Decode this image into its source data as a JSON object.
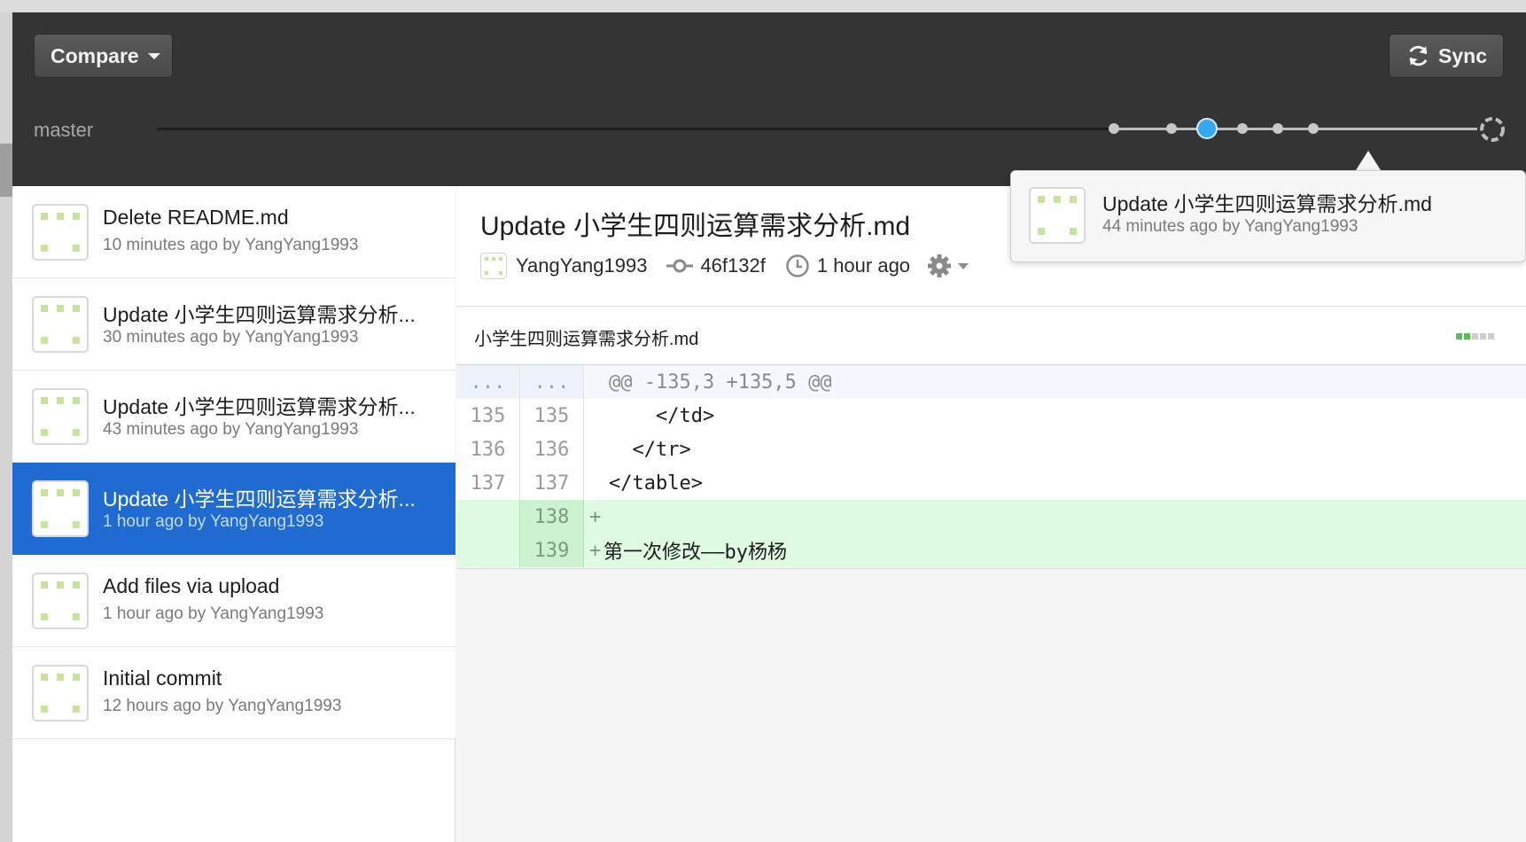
{
  "header": {
    "compare_label": "Compare",
    "sync_label": "Sync",
    "branch": "master"
  },
  "commits": [
    {
      "title": "Delete README.md",
      "meta": "10 minutes ago by YangYang1993",
      "selected": false
    },
    {
      "title": "Update 小学生四则运算需求分析...",
      "meta": "30 minutes ago by YangYang1993",
      "selected": false
    },
    {
      "title": "Update 小学生四则运算需求分析...",
      "meta": "43 minutes ago by YangYang1993",
      "selected": false
    },
    {
      "title": "Update 小学生四则运算需求分析...",
      "meta": "1 hour ago by YangYang1993",
      "selected": true
    },
    {
      "title": "Add files via upload",
      "meta": "1 hour ago by YangYang1993",
      "selected": false
    },
    {
      "title": "Initial commit",
      "meta": "12 hours ago by YangYang1993",
      "selected": false
    }
  ],
  "detail": {
    "title": "Update 小学生四则运算需求分析.md",
    "author": "YangYang1993",
    "sha": "46f132f",
    "time": "1 hour ago"
  },
  "file": {
    "name": "小学生四则运算需求分析.md"
  },
  "diff": {
    "hunk": {
      "old": "...",
      "new": "...",
      "code": "@@ -135,3 +135,5 @@"
    },
    "rows": [
      {
        "old": "135",
        "new": "135",
        "code": "    </td>"
      },
      {
        "old": "136",
        "new": "136",
        "code": "  </tr>"
      },
      {
        "old": "137",
        "new": "137",
        "code": "</table>"
      }
    ],
    "added": [
      {
        "new": "138",
        "sign": "+",
        "code": ""
      },
      {
        "new": "139",
        "sign": "+",
        "code": "第一次修改——by杨杨"
      }
    ]
  },
  "popover": {
    "title": "Update 小学生四则运算需求分析.md",
    "meta": "44 minutes ago by YangYang1993"
  },
  "colors": {
    "header_bg": "#343434",
    "selected_bg": "#1f6bd2",
    "timeline_active": "#35a8f0",
    "diff_added_bg": "#dffbe1"
  }
}
